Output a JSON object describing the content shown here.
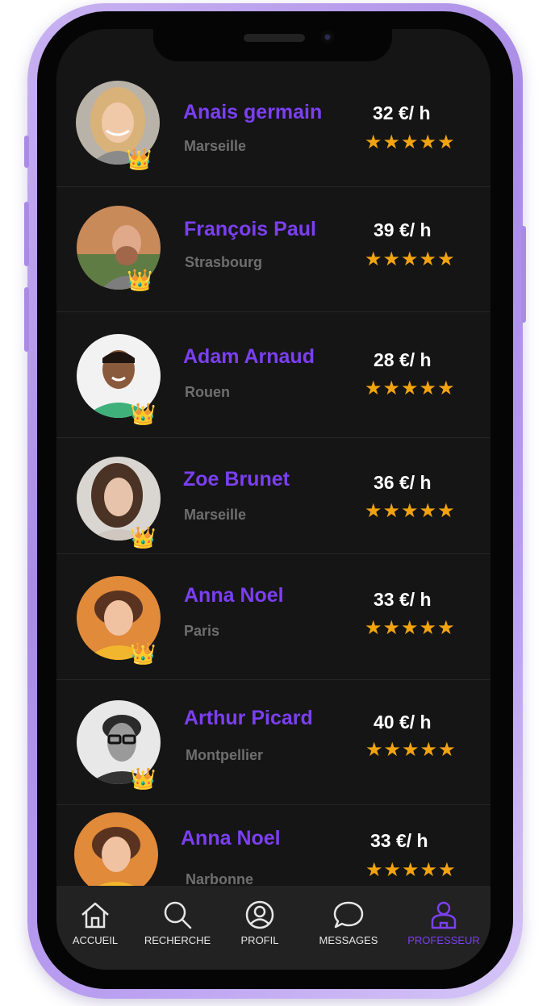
{
  "teachers": [
    {
      "name": "Anais germain",
      "city": "Marseille",
      "price": "32 €/ h",
      "stars": "★★★★★",
      "rating": 5
    },
    {
      "name": "François Paul",
      "city": "Strasbourg",
      "price": "39 €/ h",
      "stars": "★★★★★",
      "rating": 5
    },
    {
      "name": "Adam Arnaud",
      "city": "Rouen",
      "price": "28 €/ h",
      "stars": "★★★★★",
      "rating": 5
    },
    {
      "name": "Zoe Brunet",
      "city": "Marseille",
      "price": "36 €/ h",
      "stars": "★★★★★",
      "rating": 5
    },
    {
      "name": "Anna Noel",
      "city": "Paris",
      "price": "33 €/ h",
      "stars": "★★★★★",
      "rating": 5
    },
    {
      "name": "Arthur Picard",
      "city": "Montpellier",
      "price": "40 €/ h",
      "stars": "★★★★★",
      "rating": 5
    },
    {
      "name": "Anna Noel",
      "city": "Narbonne",
      "price": "33 €/ h",
      "stars": "★★★★★",
      "rating": 5
    }
  ],
  "badge_glyph": "👑",
  "tabs": [
    {
      "label": "ACCUEIL",
      "icon": "home-icon"
    },
    {
      "label": "RECHERCHE",
      "icon": "search-icon"
    },
    {
      "label": "PROFIL",
      "icon": "profile-icon"
    },
    {
      "label": "MESSAGES",
      "icon": "message-icon"
    },
    {
      "label": "PROFESSEUR",
      "icon": "teacher-icon",
      "active": true
    }
  ],
  "colors": {
    "accent": "#7b3ff2",
    "star": "#f2a30f",
    "background": "#151515",
    "tabbar": "#222222",
    "frame": "#a98be6"
  }
}
